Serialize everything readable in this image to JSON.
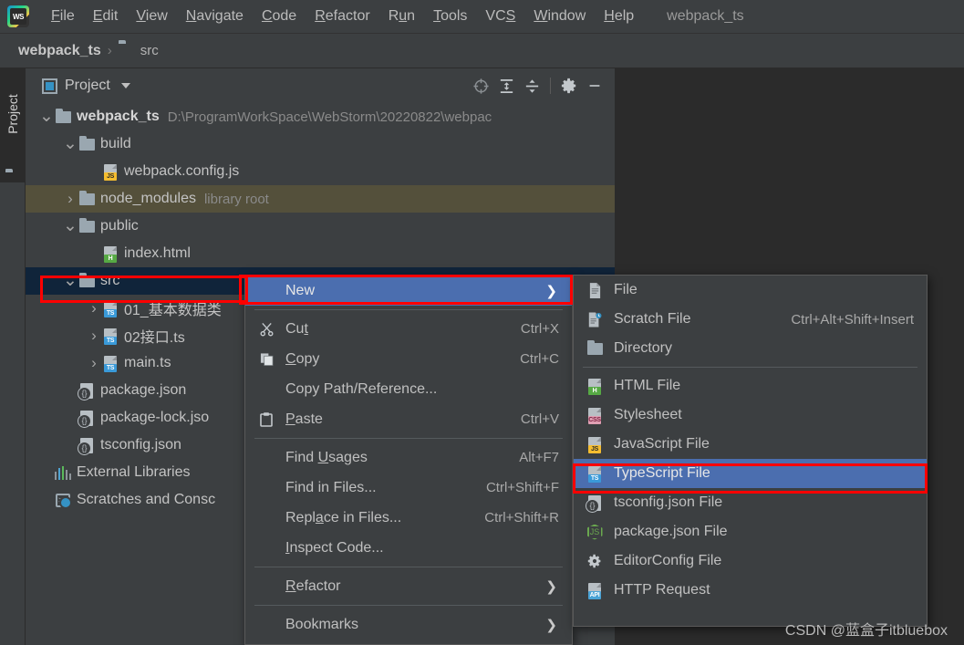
{
  "app": {
    "logo_icon": "webstorm-logo-icon",
    "project_name": "webpack_ts"
  },
  "menubar": {
    "items": [
      {
        "label": "File",
        "mnemonic": "F"
      },
      {
        "label": "Edit",
        "mnemonic": "E"
      },
      {
        "label": "View",
        "mnemonic": "V"
      },
      {
        "label": "Navigate",
        "mnemonic": "N"
      },
      {
        "label": "Code",
        "mnemonic": "C"
      },
      {
        "label": "Refactor",
        "mnemonic": "R"
      },
      {
        "label": "Run",
        "mnemonic": "u"
      },
      {
        "label": "Tools",
        "mnemonic": "T"
      },
      {
        "label": "VCS",
        "mnemonic": "S"
      },
      {
        "label": "Window",
        "mnemonic": "W"
      },
      {
        "label": "Help",
        "mnemonic": "H"
      }
    ]
  },
  "breadcrumb": {
    "root": "webpack_ts",
    "separator": "›",
    "folder_icon": "folder-icon",
    "current": "src"
  },
  "toolstrip": {
    "project_tab_label": "Project",
    "folder_icon": "folder-icon"
  },
  "project_panel": {
    "title": "Project",
    "title_icon": "project-view-icon",
    "dropdown_icon": "chevron-down-icon",
    "actions": [
      {
        "name": "locate-icon",
        "glyph": "⊕"
      },
      {
        "name": "expand-all-icon",
        "glyph": "⤒"
      },
      {
        "name": "collapse-all-icon",
        "glyph": "⤓"
      },
      {
        "name": "settings-gear-icon",
        "glyph": "⚙"
      },
      {
        "name": "hide-icon",
        "glyph": "—"
      }
    ],
    "tree": [
      {
        "name": "webpack_ts",
        "icon": "folder-icon",
        "arrow": "expanded",
        "indent": 0,
        "bold": true,
        "sub": "D:\\ProgramWorkSpace\\WebStorm\\20220822\\webpac",
        "highlight": "none"
      },
      {
        "name": "build",
        "icon": "folder-icon",
        "arrow": "expanded",
        "indent": 1,
        "bold": false,
        "sub": "",
        "highlight": "none"
      },
      {
        "name": "webpack.config.js",
        "icon": "js-file-icon",
        "arrow": "none",
        "indent": 2,
        "bold": false,
        "sub": "",
        "highlight": "none"
      },
      {
        "name": "node_modules",
        "icon": "folder-icon",
        "arrow": "collapsed",
        "indent": 1,
        "bold": false,
        "sub": "library root",
        "highlight": "olive"
      },
      {
        "name": "public",
        "icon": "folder-icon",
        "arrow": "expanded",
        "indent": 1,
        "bold": false,
        "sub": "",
        "highlight": "none"
      },
      {
        "name": "index.html",
        "icon": "html-file-icon",
        "arrow": "none",
        "indent": 2,
        "bold": false,
        "sub": "",
        "highlight": "none"
      },
      {
        "name": "src",
        "icon": "folder-icon",
        "arrow": "expanded",
        "indent": 1,
        "bold": false,
        "sub": "",
        "highlight": "selected"
      },
      {
        "name": "01_基本数据类",
        "icon": "ts-file-icon",
        "arrow": "collapsed",
        "indent": 2,
        "bold": false,
        "sub": "",
        "highlight": "none"
      },
      {
        "name": "02接口.ts",
        "icon": "ts-file-icon",
        "arrow": "collapsed",
        "indent": 2,
        "bold": false,
        "sub": "",
        "highlight": "none"
      },
      {
        "name": "main.ts",
        "icon": "ts-file-icon",
        "arrow": "collapsed",
        "indent": 2,
        "bold": false,
        "sub": "",
        "highlight": "none"
      },
      {
        "name": "package.json",
        "icon": "json-file-icon",
        "arrow": "none",
        "indent": 1,
        "bold": false,
        "sub": "",
        "highlight": "none"
      },
      {
        "name": "package-lock.jso",
        "icon": "json-file-icon",
        "arrow": "none",
        "indent": 1,
        "bold": false,
        "sub": "",
        "highlight": "none"
      },
      {
        "name": "tsconfig.json",
        "icon": "json-file-icon",
        "arrow": "none",
        "indent": 1,
        "bold": false,
        "sub": "",
        "highlight": "none"
      },
      {
        "name": "External Libraries",
        "icon": "libraries-icon",
        "arrow": "none",
        "indent": 0,
        "bold": false,
        "sub": "",
        "highlight": "none"
      },
      {
        "name": "Scratches and Consc",
        "icon": "scratches-icon",
        "arrow": "none",
        "indent": 0,
        "bold": false,
        "sub": "",
        "highlight": "none"
      }
    ]
  },
  "context_menu": {
    "items": [
      {
        "label": "New",
        "shortcut": "",
        "icon": "",
        "submenu": true,
        "selected": true,
        "underline_index": -1,
        "separator_after": true
      },
      {
        "label": "Cut",
        "shortcut": "Ctrl+X",
        "icon": "cut-icon",
        "submenu": false,
        "selected": false,
        "underline_index": 2,
        "separator_after": false
      },
      {
        "label": "Copy",
        "shortcut": "Ctrl+C",
        "icon": "copy-icon",
        "submenu": false,
        "selected": false,
        "underline_index": 0,
        "separator_after": false
      },
      {
        "label": "Copy Path/Reference...",
        "shortcut": "",
        "icon": "",
        "submenu": false,
        "selected": false,
        "underline_index": -1,
        "separator_after": false
      },
      {
        "label": "Paste",
        "shortcut": "Ctrl+V",
        "icon": "paste-icon",
        "submenu": false,
        "selected": false,
        "underline_index": 0,
        "separator_after": true
      },
      {
        "label": "Find Usages",
        "shortcut": "Alt+F7",
        "icon": "",
        "submenu": false,
        "selected": false,
        "underline_index": 5,
        "separator_after": false
      },
      {
        "label": "Find in Files...",
        "shortcut": "Ctrl+Shift+F",
        "icon": "",
        "submenu": false,
        "selected": false,
        "underline_index": -1,
        "separator_after": false
      },
      {
        "label": "Replace in Files...",
        "shortcut": "Ctrl+Shift+R",
        "icon": "",
        "submenu": false,
        "selected": false,
        "underline_index": 4,
        "separator_after": false
      },
      {
        "label": "Inspect Code...",
        "shortcut": "",
        "icon": "",
        "submenu": false,
        "selected": false,
        "underline_index": 0,
        "separator_after": true
      },
      {
        "label": "Refactor",
        "shortcut": "",
        "icon": "",
        "submenu": true,
        "selected": false,
        "underline_index": 0,
        "separator_after": true
      },
      {
        "label": "Bookmarks",
        "shortcut": "",
        "icon": "",
        "submenu": true,
        "selected": false,
        "underline_index": -1,
        "separator_after": false
      }
    ]
  },
  "submenu": {
    "items": [
      {
        "label": "File",
        "shortcut": "",
        "icon": "file-icon",
        "selected": false,
        "separator_after": false
      },
      {
        "label": "Scratch File",
        "shortcut": "Ctrl+Alt+Shift+Insert",
        "icon": "scratch-file-icon",
        "selected": false,
        "separator_after": false
      },
      {
        "label": "Directory",
        "shortcut": "",
        "icon": "directory-icon",
        "selected": false,
        "separator_after": true
      },
      {
        "label": "HTML File",
        "shortcut": "",
        "icon": "html-file-icon",
        "selected": false,
        "separator_after": false
      },
      {
        "label": "Stylesheet",
        "shortcut": "",
        "icon": "css-file-icon",
        "selected": false,
        "separator_after": false
      },
      {
        "label": "JavaScript File",
        "shortcut": "",
        "icon": "js-file-icon",
        "selected": false,
        "separator_after": false
      },
      {
        "label": "TypeScript File",
        "shortcut": "",
        "icon": "ts-file-icon",
        "selected": true,
        "separator_after": false
      },
      {
        "label": "tsconfig.json File",
        "shortcut": "",
        "icon": "json-file-icon",
        "selected": false,
        "separator_after": false
      },
      {
        "label": "package.json File",
        "shortcut": "",
        "icon": "node-json-icon",
        "selected": false,
        "separator_after": false
      },
      {
        "label": "EditorConfig File",
        "shortcut": "",
        "icon": "gear-icon",
        "selected": false,
        "separator_after": false
      },
      {
        "label": "HTTP Request",
        "shortcut": "",
        "icon": "api-file-icon",
        "selected": false,
        "separator_after": false
      }
    ]
  },
  "annotations": {
    "color": "#ff0000",
    "boxes": [
      {
        "name": "src-tree-row-highlight"
      },
      {
        "name": "new-menu-item-highlight"
      },
      {
        "name": "typescript-file-item-highlight"
      }
    ]
  },
  "watermark": {
    "text": "CSDN @蓝盒子itbluebox"
  },
  "colors": {
    "window_bg": "#3c3f41",
    "editor_bg": "#2b2b2b",
    "menu_selection": "#4b6eaf",
    "tree_selection": "#10243a",
    "library_root_row": "#54503b",
    "annotation_red": "#ff0000",
    "accent_blue": "#3592c4"
  }
}
